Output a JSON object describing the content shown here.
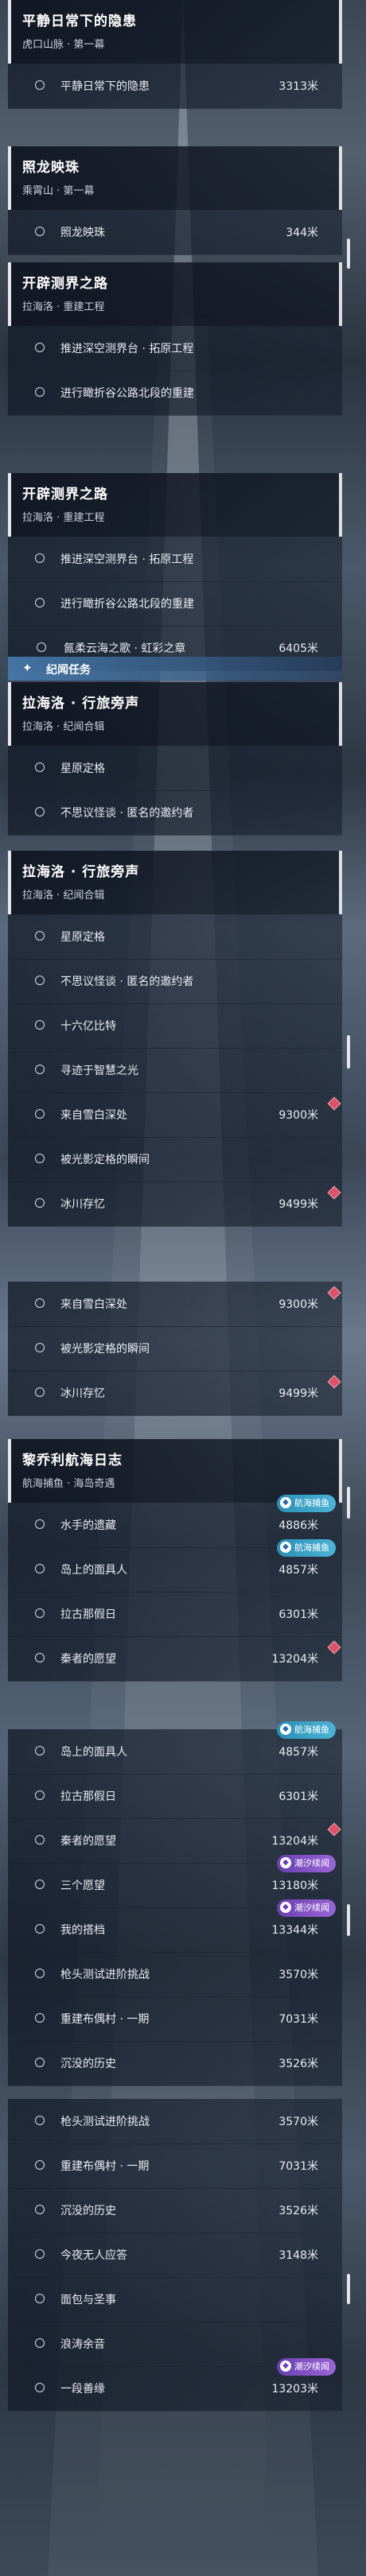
{
  "scrollbar_color": "#ffffff",
  "quest_groups": [
    {
      "title": "平静日常下的隐患",
      "subtitle": "虎口山脉 · 第一幕",
      "items": [
        {
          "label": "平静日常下的隐患",
          "distance": "3313米"
        }
      ]
    },
    {
      "title": "照龙映珠",
      "subtitle": "乘霄山 · 第一幕",
      "items": [
        {
          "label": "照龙映珠",
          "distance": "344米"
        }
      ]
    },
    {
      "title": "开辟测界之路",
      "subtitle": "拉海洛 · 重建工程",
      "items": [
        {
          "label": "推进深空测界台 · 拓原工程"
        },
        {
          "label": "进行瞰折谷公路北段的重建"
        }
      ]
    },
    {
      "title": "开辟测界之路",
      "subtitle": "拉海洛 · 重建工程",
      "items": [
        {
          "label": "推进深空测界台 · 拓原工程"
        },
        {
          "label": "进行瞰折谷公路北段的重建"
        },
        {
          "label": "氤柔云海之歌 · 虹彩之章",
          "distance": "6405米",
          "top_level": true
        }
      ]
    },
    {
      "section": {
        "label": "纪闻任务",
        "icon": "star-icon"
      },
      "title": "拉海洛 · 行旅旁声",
      "subtitle": "拉海洛 · 纪闻合辑",
      "items": [
        {
          "label": "星原定格"
        },
        {
          "label": "不思议怪谈 · 匿名的邀约者"
        }
      ]
    },
    {
      "title": "拉海洛 · 行旅旁声",
      "subtitle": "拉海洛 · 纪闻合辑",
      "items": [
        {
          "label": "星原定格"
        },
        {
          "label": "不思议怪谈 · 匿名的邀约者"
        },
        {
          "label": "十六亿比特"
        },
        {
          "label": "寻迹于智慧之光"
        },
        {
          "label": "来自雪白深处",
          "distance": "9300米",
          "diamond": true
        },
        {
          "label": "被光影定格的瞬间"
        },
        {
          "label": "冰川存忆",
          "distance": "9499米",
          "diamond": true
        }
      ]
    },
    {
      "items": [
        {
          "label": "来自雪白深处",
          "distance": "9300米",
          "diamond": true
        },
        {
          "label": "被光影定格的瞬间"
        },
        {
          "label": "冰川存忆",
          "distance": "9499米",
          "diamond": true
        }
      ]
    },
    {
      "title": "黎乔利航海日志",
      "subtitle": "航海捕鱼 · 海岛奇遇",
      "items": [
        {
          "label": "水手的遗藏",
          "distance": "4886米",
          "tag": "航海捕鱼",
          "tag_color": "blue"
        },
        {
          "label": "岛上的面具人",
          "distance": "4857米",
          "tag": "航海捕鱼",
          "tag_color": "blue"
        },
        {
          "label": "拉古那假日",
          "distance": "6301米"
        },
        {
          "label": "秦者的愿望",
          "distance": "13204米",
          "diamond": true
        }
      ]
    },
    {
      "items": [
        {
          "label": "岛上的面具人",
          "distance": "4857米",
          "tag": "航海捕鱼",
          "tag_color": "blue"
        },
        {
          "label": "拉古那假日",
          "distance": "6301米"
        },
        {
          "label": "秦者的愿望",
          "distance": "13204米",
          "diamond": true
        },
        {
          "label": "三个愿望",
          "distance": "13180米",
          "tag": "潮汐续闻",
          "tag_color": "purple"
        },
        {
          "label": "我的搭档",
          "distance": "13344米",
          "tag": "潮汐续闻",
          "tag_color": "purple"
        },
        {
          "label": "枪头测试进阶挑战",
          "distance": "3570米"
        },
        {
          "label": "重建布偶村 · 一期",
          "distance": "7031米"
        },
        {
          "label": "沉没的历史",
          "distance": "3526米"
        }
      ]
    },
    {
      "items": [
        {
          "label": "枪头测试进阶挑战",
          "distance": "3570米"
        },
        {
          "label": "重建布偶村 · 一期",
          "distance": "7031米"
        },
        {
          "label": "沉没的历史",
          "distance": "3526米"
        },
        {
          "label": "今夜无人应答",
          "distance": "3148米"
        },
        {
          "label": "面包与圣事"
        },
        {
          "label": "浪涛余音"
        },
        {
          "label": "一段善缘",
          "distance": "13203米",
          "tag": "潮汐续闻",
          "tag_color": "purple"
        }
      ]
    }
  ]
}
